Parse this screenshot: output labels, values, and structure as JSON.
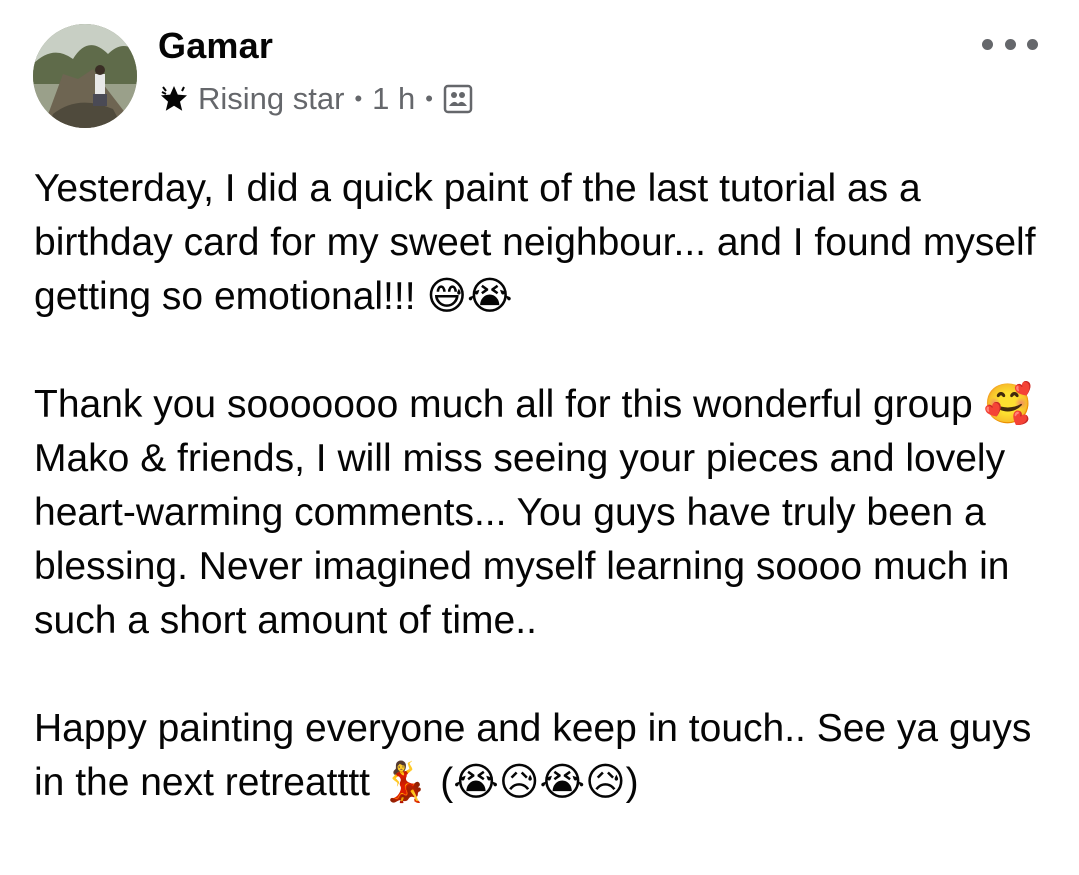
{
  "author": {
    "name": "Gamar",
    "badge": "Rising star",
    "time": "1 h",
    "dot": "•",
    "audience_icon": "group-members-icon",
    "badge_icon": "star-icon",
    "avatar_icon": "profile-photo"
  },
  "menu": {
    "more_icon": "more-options-icon"
  },
  "post": {
    "paragraphs": [
      "Yesterday, I did a quick paint of the last tutorial as a birthday card for my sweet neighbour... and I found myself getting so emotional!!! 😅😭",
      "Thank you sooooooo much all for this wonderful group 🥰 Mako & friends, I will miss seeing your pieces and lovely heart-warming comments... You guys have truly been a blessing. Never imagined myself learning soooo much in such a short amount of time..",
      "Happy painting everyone and keep in touch.. See ya guys in the next retreatttt 💃 (😭😥😭😥)"
    ]
  },
  "colors": {
    "text": "#050505",
    "secondary": "#65676b",
    "background": "#ffffff"
  }
}
